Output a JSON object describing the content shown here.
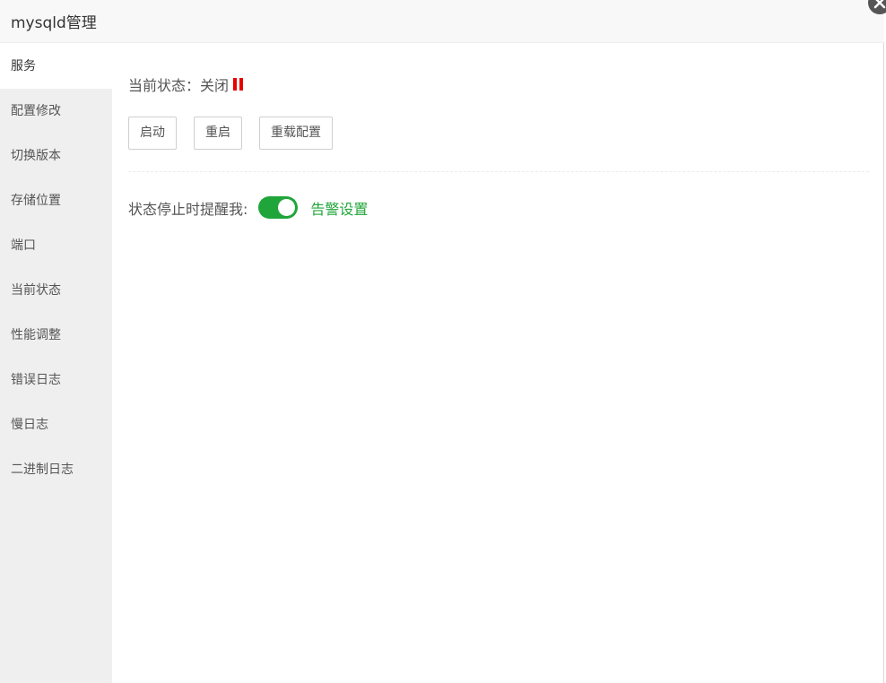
{
  "window": {
    "title": "mysqld管理"
  },
  "sidebar": {
    "items": [
      {
        "label": "服务",
        "active": true
      },
      {
        "label": "配置修改"
      },
      {
        "label": "切换版本"
      },
      {
        "label": "存储位置"
      },
      {
        "label": "端口"
      },
      {
        "label": "当前状态"
      },
      {
        "label": "性能调整"
      },
      {
        "label": "错误日志"
      },
      {
        "label": "慢日志"
      },
      {
        "label": "二进制日志"
      }
    ]
  },
  "service": {
    "status_label": "当前状态：",
    "status_value": "关闭",
    "status_color": "#e80000",
    "buttons": {
      "start": "启动",
      "restart": "重启",
      "reload": "重载配置"
    },
    "alert_label": "状态停止时提醒我:",
    "alert_enabled": true,
    "alert_settings_link": "告警设置",
    "accent_color": "#20a53a"
  },
  "icons": {
    "close": "close-icon",
    "status": "stop-icon"
  }
}
